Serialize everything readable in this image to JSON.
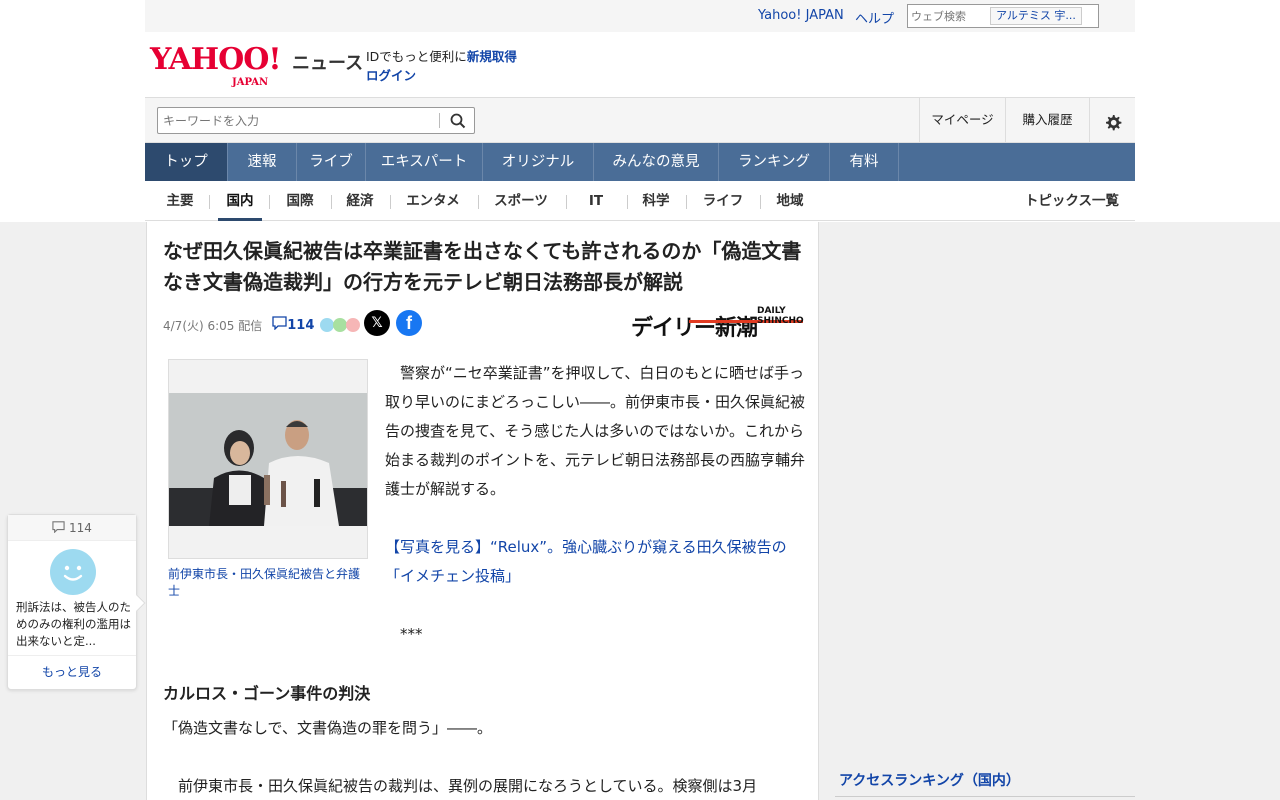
{
  "util": {
    "yahoo_japan": "Yahoo! JAPAN",
    "help": "ヘルプ",
    "web_search_placeholder": "ウェブ検索",
    "search_suggest": "アルテミス 宇..."
  },
  "masthead": {
    "logo_text": "YAHOO!",
    "logo_japan": "JAPAN",
    "news": "ニュース",
    "id_text": "IDでもっと便利に",
    "signup": "新規取得",
    "login": "ログイン"
  },
  "search": {
    "placeholder": "キーワードを入力",
    "mypage": "マイページ",
    "purchase_history": "購入履歴"
  },
  "main_nav": [
    "トップ",
    "速報",
    "ライブ",
    "エキスパート",
    "オリジナル",
    "みんなの意見",
    "ランキング",
    "有料"
  ],
  "sub_nav": [
    "主要",
    "国内",
    "国際",
    "経済",
    "エンタメ",
    "スポーツ",
    "IT",
    "科学",
    "ライフ",
    "地域"
  ],
  "topics_list": "トピックス一覧",
  "article": {
    "title": "なぜ田久保眞紀被告は卒業証書を出さなくても許されるのか「偽造文書なき文書偽造裁判」の行方を元テレビ朝日法務部長が解説",
    "date": "4/7(火) 6:05 配信",
    "comment_count": "114",
    "source_logo": "デイリー新潮",
    "source_logo_en_1": "DAILY",
    "source_logo_en_2": "SHINCHO",
    "photo_caption": "前伊東市長・田久保眞紀被告と弁護士",
    "lead": "　警察が“ニセ卒業証書”を押収して、白日のもとに晒せば手っ取り早いのにまどろっこしい――。前伊東市長・田久保眞紀被告の捜査を見て、そう感じた人は多いのではないか。これから始まる裁判のポイントを、元テレビ朝日法務部長の西脇亨輔弁護士が解説する。",
    "photo_link": "【写真を見る】“Relux”。強心臓ぶりが窺える田久保被告の「イメチェン投稿」",
    "stars": "***",
    "heading": "カルロス・ゴーン事件の判決",
    "para1": "「偽造文書なしで、文書偽造の罪を問う」――。",
    "para2": "　前伊東市長・田久保眞紀被告の裁判は、異例の展開になろうとしている。検察側は3月"
  },
  "comment_widget": {
    "count": "114",
    "text": "刑訴法は、被告人のためのみの権利の濫用は出来ないと定...",
    "more": "もっと見る"
  },
  "sidebar": {
    "access_ranking": "アクセスランキング（国内）"
  },
  "colors": {
    "nav_bg": "#4a6d97",
    "nav_active": "#2d4a6e",
    "link": "#1245a8",
    "brand_red": "#e60033"
  }
}
